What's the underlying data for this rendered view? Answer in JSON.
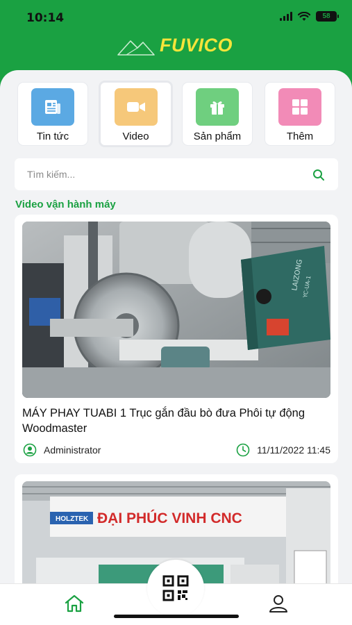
{
  "status_bar": {
    "time": "10:14",
    "battery": "58"
  },
  "app": {
    "brand": "FUVICO",
    "brand_color": "#1aa142",
    "accent_yellow": "#f5e43a"
  },
  "quick_menu": [
    {
      "label": "Tin tức",
      "icon": "newspaper-icon",
      "bg": "#5ba9e3",
      "active": false
    },
    {
      "label": "Video",
      "icon": "video-camera-icon",
      "bg": "#f6c87a",
      "active": true
    },
    {
      "label": "Sản phẩm",
      "icon": "gift-icon",
      "bg": "#6fcf7f",
      "active": false
    },
    {
      "label": "Thêm",
      "icon": "grid-icon",
      "bg": "#f28bb7",
      "active": false
    }
  ],
  "search": {
    "placeholder": "Tìm kiếm...",
    "value": ""
  },
  "section": {
    "title": "Video vận hành máy"
  },
  "videos": [
    {
      "title": "MÁY PHAY TUABI 1 Trục gắn đầu bò đưa Phôi tự động Woodmaster",
      "author": "Administrator",
      "date": "11/11/2022 11:45",
      "thumb_text": [
        "LAIZONG",
        "YC-UA-1"
      ]
    },
    {
      "title": "",
      "author": "",
      "date": "",
      "thumb_text": [
        "ĐẠI PHÚC VINH CNC",
        "HOLZTEK"
      ]
    }
  ],
  "bottom_nav": {
    "home": "home-icon",
    "scan": "qr-code-icon",
    "profile": "user-icon"
  }
}
